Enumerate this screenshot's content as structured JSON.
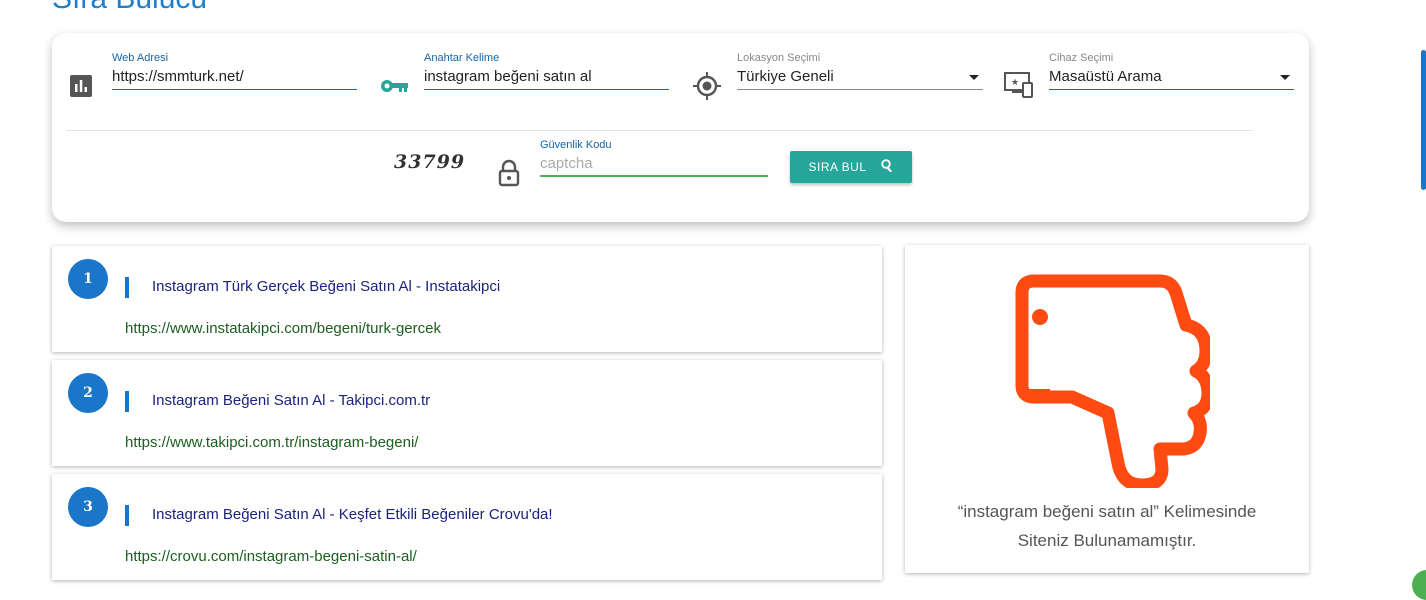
{
  "page": {
    "title": "Sıra Bulucu"
  },
  "form": {
    "web": {
      "label": "Web Adresi",
      "value": "https://smmturk.net/"
    },
    "keyword": {
      "label": "Anahtar Kelime",
      "value": "instagram beğeni satın al"
    },
    "location": {
      "label": "Lokasyon Seçimi",
      "value": "Türkiye Geneli"
    },
    "device": {
      "label": "Cihaz Seçimi",
      "value": "Masaüstü Arama"
    },
    "captcha": {
      "image_text": "33799",
      "label": "Güvenlik Kodu",
      "placeholder": "captcha"
    },
    "submit_label": "SIRA BUL"
  },
  "results": [
    {
      "rank": "1",
      "title": "Instagram Türk Gerçek Beğeni Satın Al - Instatakipci",
      "url": "https://www.instatakipci.com/begeni/turk-gercek"
    },
    {
      "rank": "2",
      "title": "Instagram Beğeni Satın Al - Takipci.com.tr",
      "url": "https://www.takipci.com.tr/instagram-begeni/"
    },
    {
      "rank": "3",
      "title": "Instagram Beğeni Satın Al - Keşfet Etkili Beğeniler Crovu'da!",
      "url": "https://crovu.com/instagram-begeni-satin-al/"
    }
  ],
  "status": {
    "line1": "“instagram beğeni satın al” Kelimesinde",
    "line2": "Siteniz Bulunamamıştır.",
    "icon": "thumbs-down-icon",
    "icon_color": "#ff4a12"
  },
  "colors": {
    "accent": "#1976c8",
    "button": "#26a69a",
    "url": "#1b5e20",
    "title": "#1a237e"
  }
}
